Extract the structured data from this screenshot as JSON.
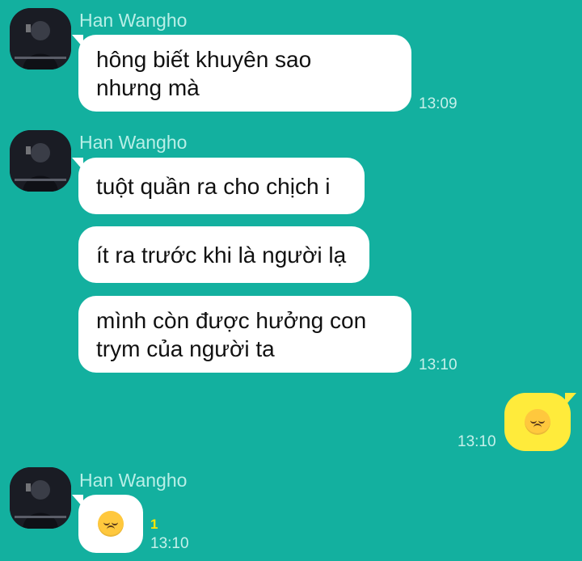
{
  "messages": [
    {
      "sender": "Han Wangho",
      "bubbles": [
        "hông biết khuyên sao\nnhưng mà"
      ],
      "time": "13:09"
    },
    {
      "sender": "Han Wangho",
      "bubbles": [
        "tuột quần ra cho chịch i",
        "ít ra trước khi là người lạ",
        "mình còn được hưởng con\ntrym của người ta"
      ],
      "time": "13:10"
    }
  ],
  "outgoing": {
    "emoji": "disappointed-face",
    "time": "13:10"
  },
  "last_incoming": {
    "sender": "Han Wangho",
    "emoji": "disappointed-face",
    "unread_count": "1",
    "time": "13:10"
  },
  "colors": {
    "background": "#13b09f",
    "incoming_bubble": "#ffffff",
    "outgoing_bubble": "#ffeb3b",
    "unread": "#ffe600"
  }
}
